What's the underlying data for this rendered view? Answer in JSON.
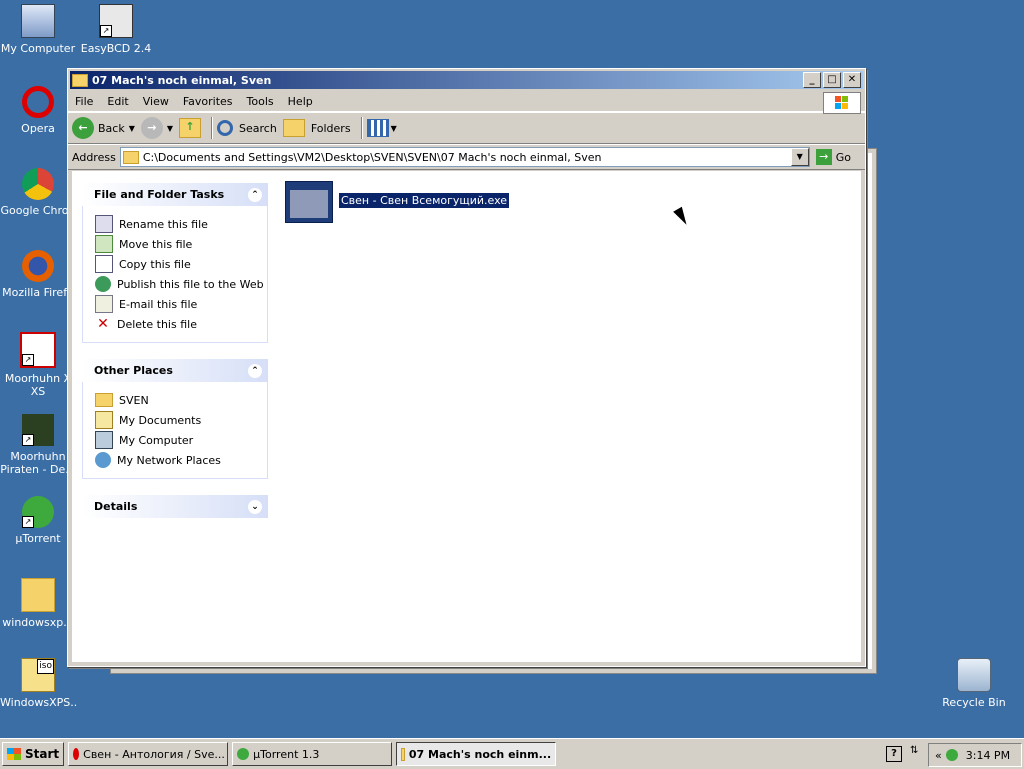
{
  "desktop": {
    "icons": [
      {
        "label": "My Computer"
      },
      {
        "label": "EasyBCD 2.4"
      },
      {
        "label": "Opera"
      },
      {
        "label": "Google Chron"
      },
      {
        "label": "Mozilla Firefo"
      },
      {
        "label": "Moorhuhn X XS"
      },
      {
        "label": "Moorhuhn Piraten - De..."
      },
      {
        "label": "µTorrent"
      },
      {
        "label": "windowsxp..."
      },
      {
        "label": "WindowsXPS..."
      },
      {
        "label": "Recycle Bin"
      }
    ],
    "iso_badge": "iso"
  },
  "window": {
    "title": "07 Mach's noch einmal, Sven",
    "menu": [
      "File",
      "Edit",
      "View",
      "Favorites",
      "Tools",
      "Help"
    ],
    "toolbar": {
      "back": "Back",
      "search": "Search",
      "folders": "Folders"
    },
    "address": {
      "label": "Address",
      "value": "C:\\Documents and Settings\\VM2\\Desktop\\SVEN\\SVEN\\07 Mach's noch einmal, Sven",
      "go": "Go"
    },
    "file_tasks": {
      "title": "File and Folder Tasks",
      "items": [
        "Rename this file",
        "Move this file",
        "Copy this file",
        "Publish this file to the Web",
        "E-mail this file",
        "Delete this file"
      ]
    },
    "other_places": {
      "title": "Other Places",
      "items": [
        "SVEN",
        "My Documents",
        "My Computer",
        "My Network Places"
      ]
    },
    "details": {
      "title": "Details"
    },
    "file": {
      "name": "Свен - Свен Всемогущий.exe"
    }
  },
  "taskbar": {
    "start": "Start",
    "tasks": [
      "Свен - Антология / Sve...",
      "µTorrent 1.3",
      "07 Mach's noch einm..."
    ],
    "clock": "3:14 PM"
  }
}
